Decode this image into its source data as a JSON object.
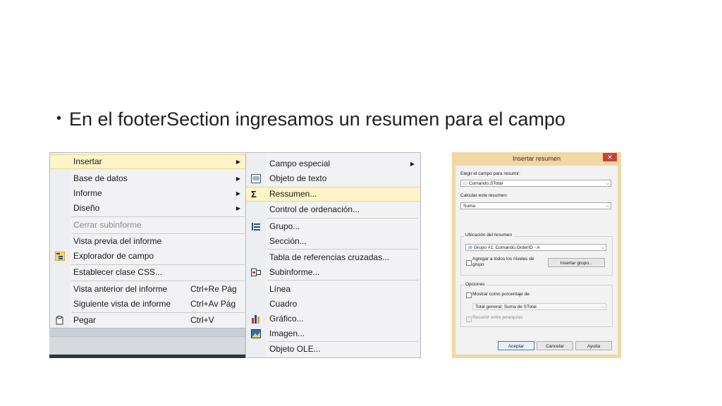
{
  "slide": {
    "bullet_text": "En el footerSection ingresamos un resumen para el campo"
  },
  "menu_main": {
    "items": [
      {
        "label": "Insertar",
        "shortcut": "",
        "submenu": true,
        "highlight": true
      },
      {
        "label": "Base de datos",
        "shortcut": "",
        "submenu": true
      },
      {
        "label": "Informe",
        "shortcut": "",
        "submenu": true
      },
      {
        "label": "Diseño",
        "shortcut": "",
        "submenu": true
      },
      {
        "label": "Cerrar subinforme",
        "shortcut": "",
        "disabled": true
      },
      {
        "label": "Vista previa del informe",
        "shortcut": ""
      },
      {
        "label": "Explorador de campo",
        "shortcut": "",
        "icon": "field-explorer-icon"
      },
      {
        "label": "Establecer clase CSS...",
        "shortcut": ""
      },
      {
        "label": "Vista anterior del informe",
        "shortcut": "Ctrl+Re Pág"
      },
      {
        "label": "Siguiente vista de informe",
        "shortcut": "Ctrl+Av Pág"
      },
      {
        "label": "Pegar",
        "shortcut": "Ctrl+V",
        "icon": "paste-icon"
      }
    ]
  },
  "menu_insert": {
    "items": [
      {
        "label": "Campo especial",
        "submenu": true
      },
      {
        "label": "Objeto de texto",
        "icon": "text-object-icon"
      },
      {
        "label": "Ressumen...",
        "icon": "sigma-icon",
        "highlight": true
      },
      {
        "label": "Control de ordenación..."
      },
      {
        "label": "Grupo...",
        "icon": "group-icon"
      },
      {
        "label": "Sección..."
      },
      {
        "label": "Tabla de referencias cruzadas..."
      },
      {
        "label": "Subinforme...",
        "icon": "subreport-icon"
      },
      {
        "label": "Línea"
      },
      {
        "label": "Cuadro"
      },
      {
        "label": "Gráfico...",
        "icon": "chart-icon"
      },
      {
        "label": "Imagen...",
        "icon": "image-icon"
      },
      {
        "label": "Objeto OLE..."
      }
    ]
  },
  "dialog": {
    "title": "Insertar resumen",
    "close_glyph": "✕",
    "field_label": "Elegir el campo para resumir:",
    "field_value": "Comando.STotal",
    "calc_label": "Calcular este resumen:",
    "calc_value": "Suma",
    "location_group": "Ubicación del resumen",
    "location_value": "Grupo #1: Comando.OrderID - A",
    "add_all_levels_line1": "Agregar a todos los niveles de",
    "add_all_levels_line2": "grupo",
    "insert_group_button": "Insertar grupo...",
    "options_group": "Opciones",
    "percent_label": "Mostrar como porcentaje de",
    "percent_value": "Total general: Suma de STotal",
    "hierarchy_label": "Resumir entre jerarquías",
    "ok_button": "Aceptar",
    "cancel_button": "Cancelar",
    "help_button": "Ayuda"
  },
  "colors": {
    "menu_highlight": "#fdf4c8",
    "dialog_frame": "#f0d7a3",
    "close_button": "#c8423b"
  }
}
